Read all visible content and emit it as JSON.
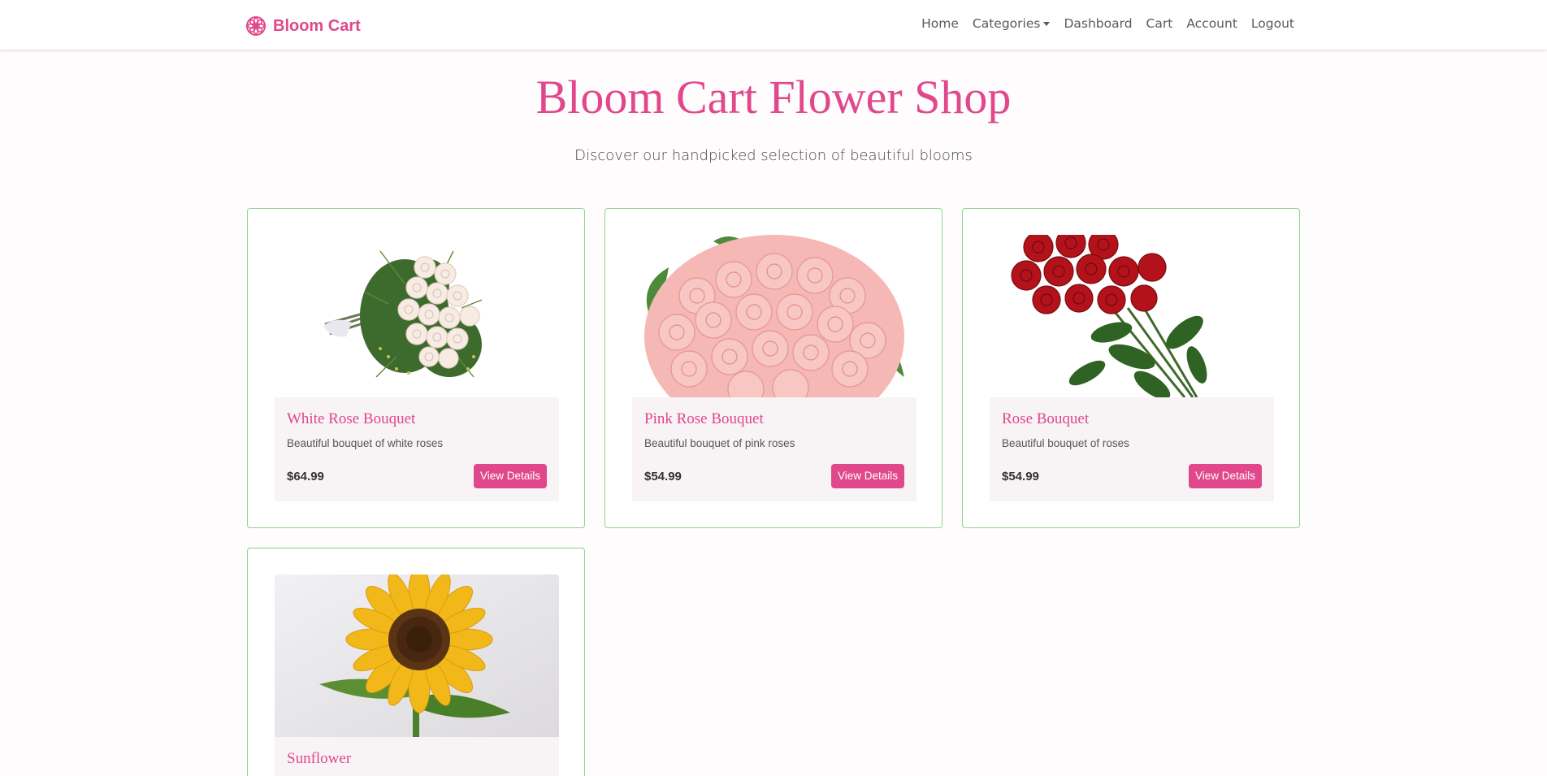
{
  "brand": {
    "name": "Bloom Cart",
    "color": "#e0488b",
    "icon": "flower-icon"
  },
  "nav": {
    "items": [
      {
        "label": "Home"
      },
      {
        "label": "Categories",
        "dropdown": true
      },
      {
        "label": "Dashboard"
      },
      {
        "label": "Cart"
      },
      {
        "label": "Account"
      },
      {
        "label": "Logout"
      }
    ]
  },
  "hero": {
    "title": "Bloom Cart Flower Shop",
    "subtitle": "Discover our handpicked selection of beautiful blooms"
  },
  "products": [
    {
      "title": "White Rose Bouquet",
      "description": "Beautiful bouquet of white roses",
      "price": "$64.99",
      "button": "View Details"
    },
    {
      "title": "Pink Rose Bouquet",
      "description": "Beautiful bouquet of pink roses",
      "price": "$54.99",
      "button": "View Details"
    },
    {
      "title": "Rose Bouquet",
      "description": "Beautiful bouquet of roses",
      "price": "$54.99",
      "button": "View Details"
    },
    {
      "title": "Sunflower"
    }
  ],
  "colors": {
    "accent": "#e0488b",
    "card_border": "#8fd48f",
    "card_body_bg": "#f8f3f5"
  }
}
